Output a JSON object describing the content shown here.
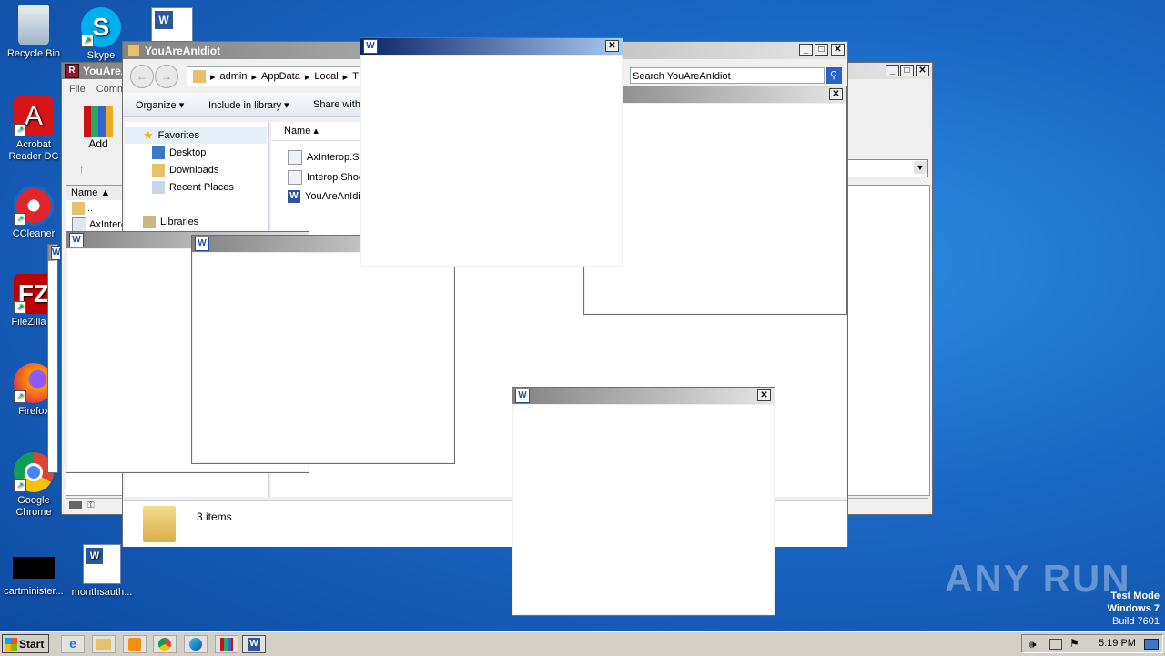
{
  "desktop": {
    "icons": [
      {
        "label": "Recycle Bin"
      },
      {
        "label": "Skype"
      },
      {
        "label": "Acrobat Reader DC"
      },
      {
        "label": "CCleaner"
      },
      {
        "label": "FileZilla C"
      },
      {
        "label": "Firefox"
      },
      {
        "label": "Google Chrome"
      },
      {
        "label": "cartminister..."
      },
      {
        "label": "monthsauth..."
      }
    ]
  },
  "winrar": {
    "title": "YouAreAn",
    "menu": [
      "File",
      "Comm"
    ],
    "add_label": "Add",
    "col_name": "Name",
    "rows": [
      "..",
      "AxInterc"
    ]
  },
  "explorer": {
    "title": "YouAreAnIdiot",
    "breadcrumb": [
      "admin",
      "AppData",
      "Local",
      "T"
    ],
    "search_placeholder": "Search YouAreAnIdiot",
    "toolbar": {
      "organize": "Organize",
      "include": "Include in library",
      "share": "Share with"
    },
    "nav": {
      "favorites": "Favorites",
      "desktop": "Desktop",
      "downloads": "Downloads",
      "recent": "Recent Places",
      "libraries": "Libraries"
    },
    "col_name": "Name",
    "files": [
      "AxInterop.Sh",
      "Interop.Shoc",
      "YouAreAnIdio"
    ],
    "status": "3 items"
  },
  "taskbar": {
    "start": "Start",
    "clock": "5:19 PM"
  },
  "watermark": {
    "brand": "ANY RUN",
    "test_mode": "Test Mode",
    "os": "Windows 7",
    "build": "Build 7601"
  },
  "colors": {
    "active_title": "#0a246a",
    "inactive_title": "#828282",
    "desktop": "#1a66c4"
  }
}
